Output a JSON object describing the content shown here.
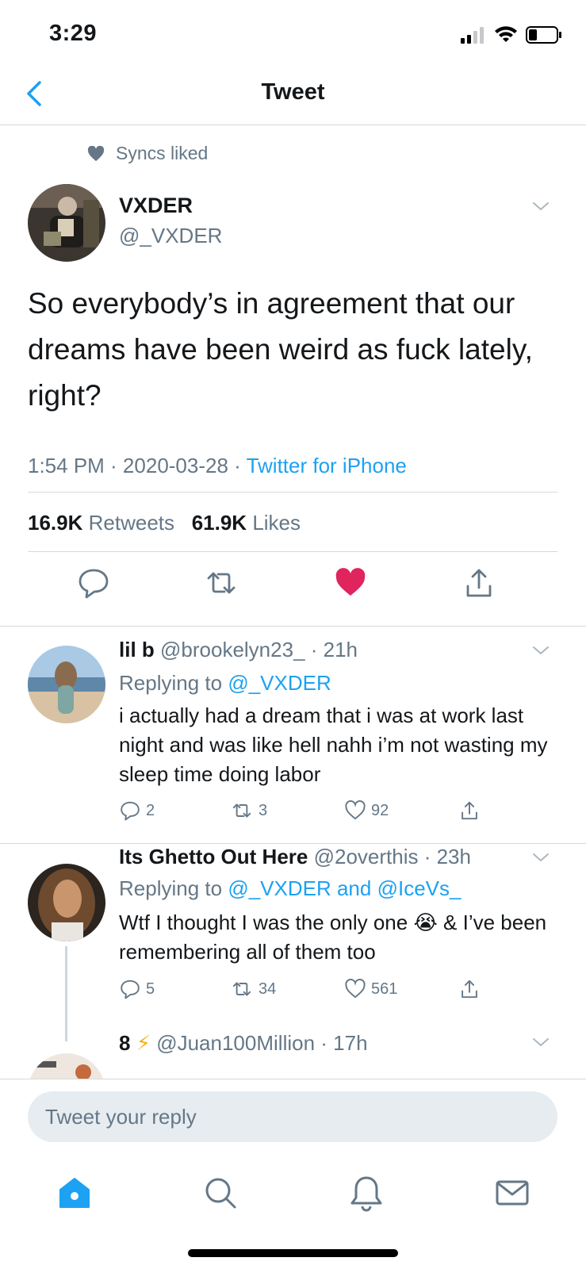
{
  "status_bar": {
    "time": "3:29"
  },
  "nav": {
    "title": "Tweet"
  },
  "main_tweet": {
    "social_context": "Syncs liked",
    "name": "VXDER",
    "handle": "@_VXDER",
    "text": "So everybody’s in agreement that our dreams have been weird as fuck lately, right?",
    "time": "1:54 PM · 2020-03-28 · ",
    "source": "Twitter for iPhone",
    "retweets_count": "16.9K",
    "retweets_label": "Retweets",
    "likes_count": "61.9K",
    "likes_label": "Likes",
    "liked": true
  },
  "replies": [
    {
      "name": "lil b",
      "handle_time": "@brookelyn23_ · 21h",
      "replying_prefix": "Replying to ",
      "replying_to": "@_VXDER",
      "text": "i actually had a dream that i was at work last night and was like hell nahh i’m not wasting my sleep time doing labor",
      "replies": "2",
      "retweets": "3",
      "likes": "92"
    },
    {
      "name": "Its Ghetto Out Here",
      "handle_time": "@2overthis · 23h",
      "replying_prefix": "Replying to ",
      "replying_to": "@_VXDER and @IceVs_",
      "text_before_emoji": "Wtf I thought I was the only one ",
      "emoji": "😭",
      "text_after_emoji": " & I’ve been remembering all of them too",
      "replies": "5",
      "retweets": "34",
      "likes": "561"
    },
    {
      "name": "8",
      "emoji": "⚡",
      "handle_time": "@Juan100Million · 17h"
    }
  ],
  "composer": {
    "placeholder": "Tweet your reply"
  },
  "colors": {
    "accent": "#1da1f2",
    "like": "#e0245e",
    "secondary_text": "#657786"
  }
}
